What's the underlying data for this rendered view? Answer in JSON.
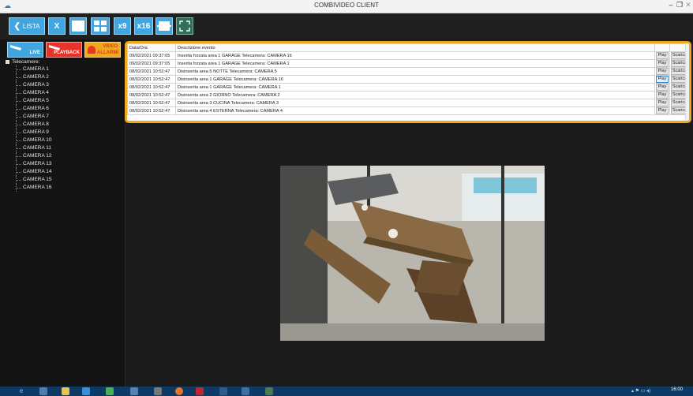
{
  "window": {
    "title": "COMBIVIDEO CLIENT",
    "minimize": "–",
    "maximize": "❐",
    "close": "✕"
  },
  "toolbar": {
    "lista": {
      "arrow": "❮",
      "label": "LISTA"
    },
    "close": "X",
    "grid_x9": "x9",
    "grid_x16": "x16"
  },
  "modes": {
    "live": "LIVE",
    "playback": "PLAYBACK",
    "video_allarmi_1": "VIDEO",
    "video_allarmi_2": "ALLARMI"
  },
  "tree": {
    "root": "Telecamere:",
    "cameras": [
      "CAMERA 1",
      "CAMERA 2",
      "CAMERA 3",
      "CAMERA 4",
      "CAMERA 5",
      "CAMERA 6",
      "CAMERA 7",
      "CAMERA 8",
      "CAMERA 9",
      "CAMERA 10",
      "CAMERA 11",
      "CAMERA 12",
      "CAMERA 13",
      "CAMERA 14",
      "CAMERA 15",
      "CAMERA 16"
    ]
  },
  "events": {
    "columns": [
      "Data/Ora",
      "Descrizione evento"
    ],
    "play_label": "Play",
    "download_label": "Scarica",
    "rows": [
      {
        "datetime": "09/02/2021 09:37:05",
        "description": "Inserita forzata area 1 GARAGE Telecamera: CAMERA 16"
      },
      {
        "datetime": "09/02/2021 09:37:05",
        "description": "Inserita forzata area 1 GARAGE Telecamera: CAMERA 1"
      },
      {
        "datetime": "08/02/2021 10:52:47",
        "description": "Disinserita area 5 NOTTE Telecamera: CAMERA 5"
      },
      {
        "datetime": "08/02/2021 10:52:47",
        "description": "Disinserita area 1 GARAGE Telecamera: CAMERA 16"
      },
      {
        "datetime": "08/02/2021 10:52:47",
        "description": "Disinserita area 1 GARAGE Telecamera: CAMERA 1"
      },
      {
        "datetime": "08/02/2021 10:52:47",
        "description": "Disinserita area 2 GIORNO  Telecamera: CAMERA 2"
      },
      {
        "datetime": "08/02/2021 10:52:47",
        "description": "Disinserita area 3 CUCINA Telecamera: CAMERA 3"
      },
      {
        "datetime": "08/02/2021 10:52:47",
        "description": "Disinserita area 4 ESTERNA Telecamera: CAMERA 4"
      }
    ]
  },
  "clock": {
    "time": "16:00"
  },
  "colors": {
    "accent": "#41a6e0",
    "highlight": "#f0a81c",
    "playback": "#e8332a",
    "taskbar": "#0e3a66"
  }
}
